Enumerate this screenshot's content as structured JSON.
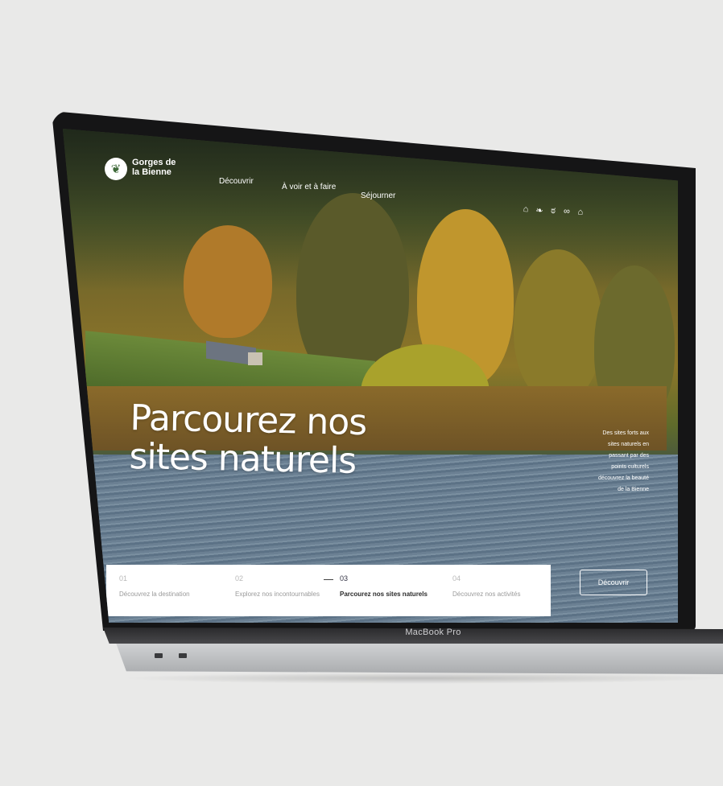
{
  "brand": {
    "line1": "Gorges de",
    "line2": "la Bienne"
  },
  "nav": {
    "items": [
      "Découvrir",
      "À voir et à faire",
      "Séjourner"
    ]
  },
  "header_icons": [
    "building-icon",
    "leaf-icon",
    "bike-icon",
    "binoculars-icon",
    "home-icon"
  ],
  "hero": {
    "title_line1": "Parcourez nos",
    "title_line2": "sites naturels",
    "side_text": [
      "Des sites forts aux",
      "sites naturels en",
      "passant par des",
      "points culturels",
      "découvrez la beauté",
      "de la Bienne"
    ]
  },
  "steps": [
    {
      "num": "01",
      "label": "Découvrez la destination",
      "active": false
    },
    {
      "num": "02",
      "label": "Explorez nos incontournables",
      "active": false
    },
    {
      "num": "03",
      "label": "Parcourez nos sites naturels",
      "active": true
    },
    {
      "num": "04",
      "label": "Découvrez nos activités",
      "active": false
    }
  ],
  "cta": {
    "label": "Découvrir"
  },
  "device": {
    "model": "MacBook Pro"
  }
}
